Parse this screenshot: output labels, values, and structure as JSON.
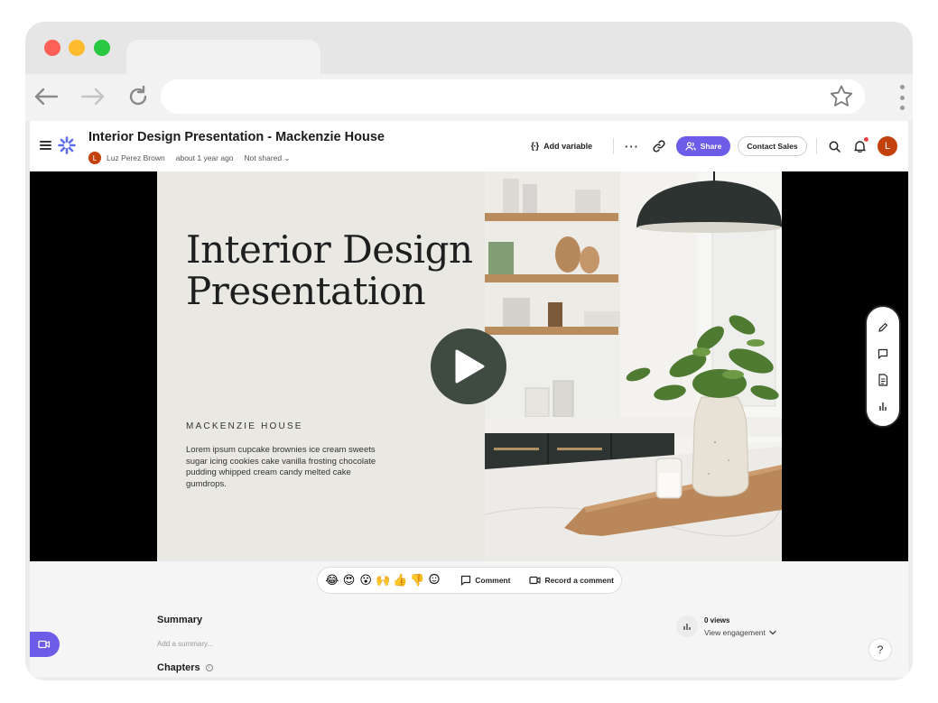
{
  "app": {
    "doc_title": "Interior Design Presentation - Mackenzie House",
    "author_initial": "L",
    "author_name": "Luz Perez Brown",
    "timestamp": "about 1 year ago",
    "sharing_status": "Not shared",
    "user_initial": "L"
  },
  "header": {
    "add_variable_label": "Add variable",
    "share_label": "Share",
    "contact_sales_label": "Contact Sales",
    "more_label": "···"
  },
  "slide": {
    "title_line1": "Interior Design",
    "title_line2": "Presentation",
    "subtitle": "MACKENZIE HOUSE",
    "body": "Lorem ipsum cupcake brownies ice cream sweets sugar icing cookies cake vanilla frosting chocolate pudding whipped cream candy melted cake gumdrops."
  },
  "reactions": {
    "emojis": [
      "😂",
      "😍",
      "😮",
      "🙌",
      "👍",
      "👎"
    ],
    "comment_label": "Comment",
    "record_label": "Record a comment"
  },
  "details": {
    "summary_title": "Summary",
    "summary_placeholder": "Add a summary...",
    "chapters_title": "Chapters",
    "views": "0 views",
    "engagement_label": "View engagement"
  },
  "help": {
    "label": "?"
  },
  "colors": {
    "accent": "#6c5ce7",
    "avatar": "#c2410c",
    "play_button": "#3f4a40",
    "slide_bg": "#e9e8e3"
  },
  "icons": {
    "side_tools": [
      "pencil-icon",
      "comment-icon",
      "transcript-icon",
      "bar-chart-icon"
    ]
  }
}
